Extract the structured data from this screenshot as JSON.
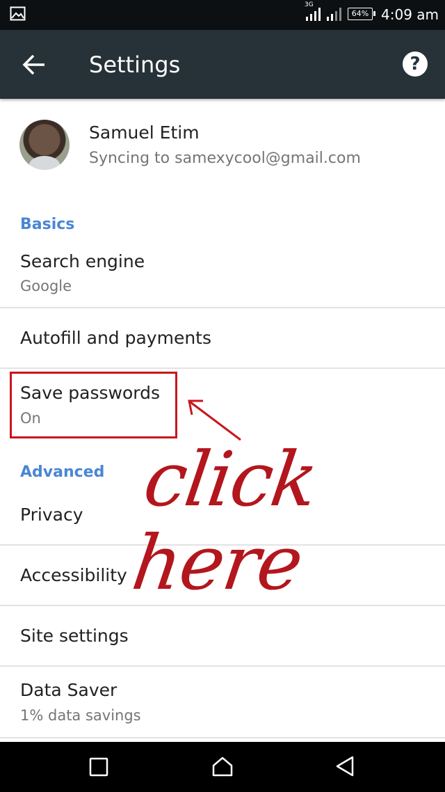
{
  "status_bar": {
    "network_type": "3G",
    "battery_level": "64%",
    "time": "4:09 am",
    "icons": [
      "image-notification-icon",
      "signal-strength-icon",
      "signal-strength-icon",
      "battery-icon"
    ]
  },
  "toolbar": {
    "title": "Settings",
    "back_icon": "arrow-back-icon",
    "help_icon": "help-circle-icon",
    "help_glyph": "?"
  },
  "account": {
    "name": "Samuel Etim",
    "sync_status": "Syncing to samexycool@gmail.com"
  },
  "sections": {
    "basics_header": "Basics",
    "advanced_header": "Advanced"
  },
  "settings": {
    "search_engine": {
      "title": "Search engine",
      "summary": "Google"
    },
    "autofill": {
      "title": "Autofill and payments"
    },
    "save_passwords": {
      "title": "Save passwords",
      "summary": "On"
    },
    "privacy": {
      "title": "Privacy"
    },
    "accessibility": {
      "title": "Accessibility"
    },
    "site_settings": {
      "title": "Site settings"
    },
    "data_saver": {
      "title": "Data Saver",
      "summary": "1% data savings"
    }
  },
  "annotation": {
    "text": "click here",
    "color": "#b3161d"
  },
  "colors": {
    "toolbar_bg": "#263238",
    "status_bar_bg": "#0d1012",
    "section_header": "#4a86d4",
    "annotation_red": "#c8161d"
  },
  "nav_bar": {
    "icons": [
      "recents-square-icon",
      "home-icon",
      "back-triangle-icon"
    ]
  }
}
